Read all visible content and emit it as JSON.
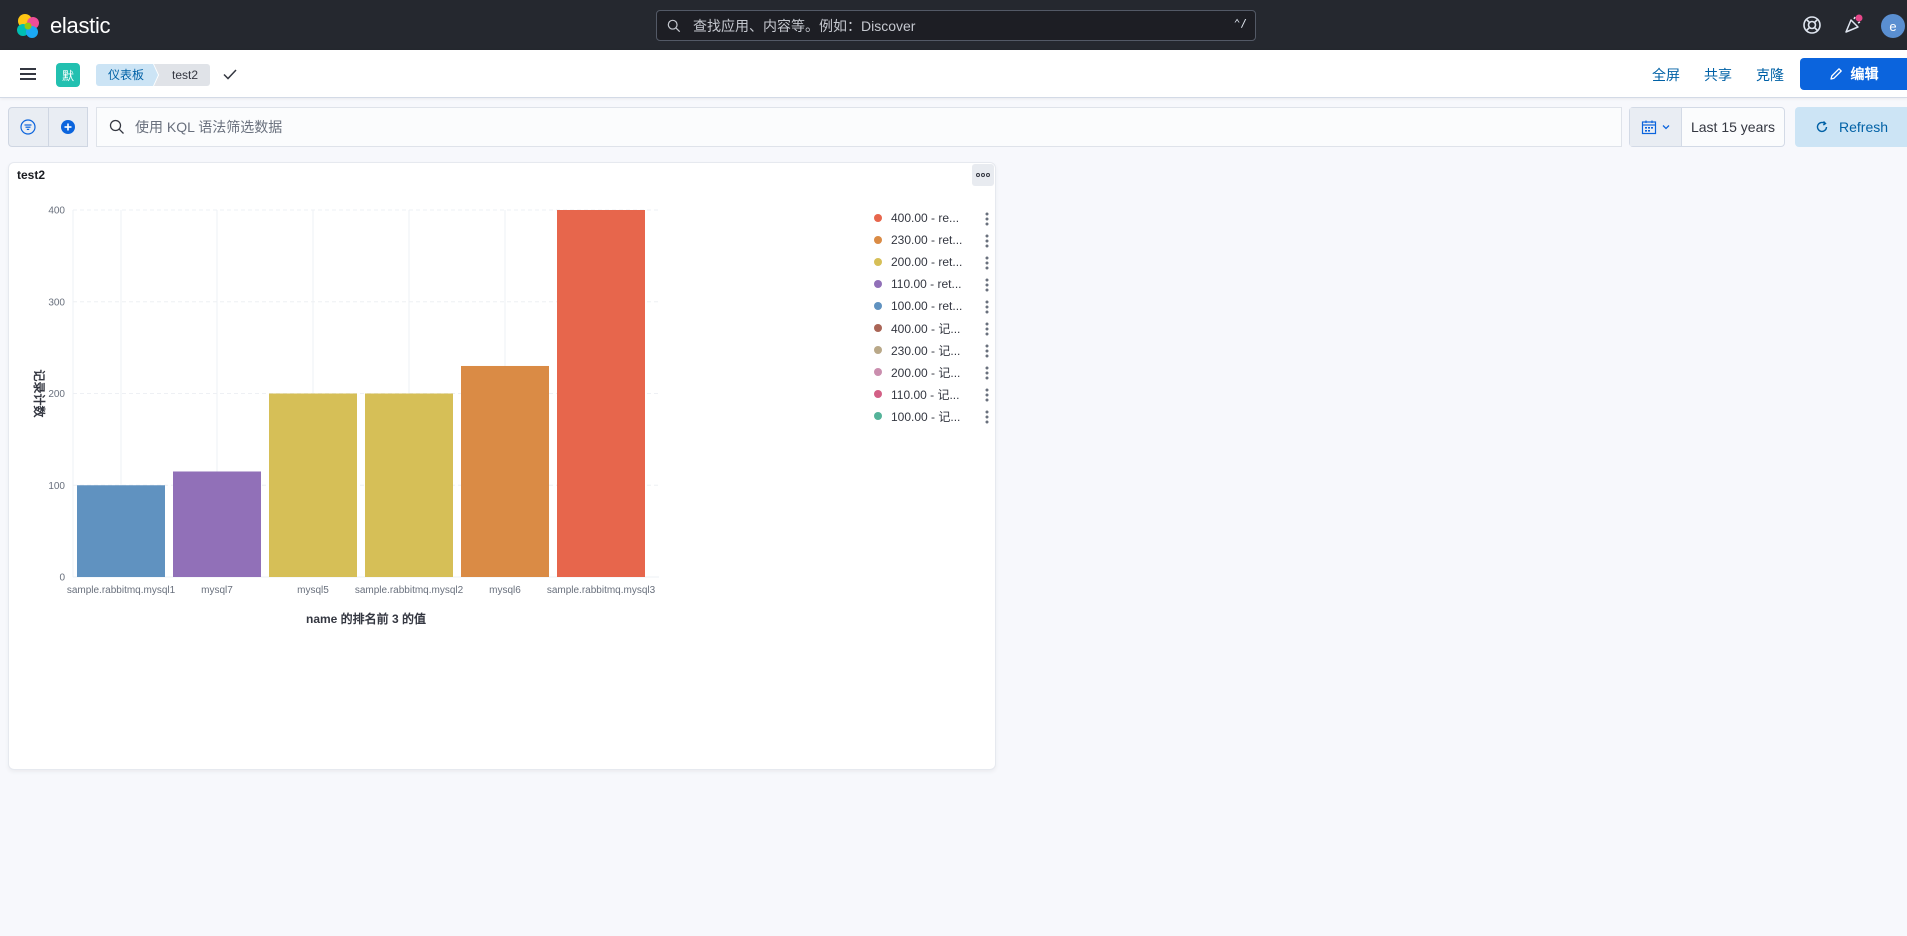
{
  "header": {
    "brand": "elastic",
    "search_placeholder": "查找应用、内容等。例如：Discover",
    "search_shortcut": "⌃/",
    "avatar_letter": "e",
    "colors": {
      "bg": "#25282f",
      "notify_dot": "#e7478a"
    }
  },
  "subbar": {
    "space_initial": "默",
    "breadcrumbs": [
      "仪表板",
      "test2"
    ],
    "fullscreen_label": "全屏",
    "share_label": "共享",
    "clone_label": "克隆",
    "edit_label": "编辑"
  },
  "query": {
    "kql_placeholder": "使用 KQL 语法筛选数据",
    "time_range": "Last 15 years",
    "refresh_label": "Refresh"
  },
  "panel": {
    "title": "test2",
    "legend": [
      {
        "label": "400.00 - re...",
        "color": "#e7664c"
      },
      {
        "label": "230.00 - ret...",
        "color": "#da8b45"
      },
      {
        "label": "200.00 - ret...",
        "color": "#d6bf57"
      },
      {
        "label": "110.00 - ret...",
        "color": "#9170b8"
      },
      {
        "label": "100.00 - ret...",
        "color": "#6092c0"
      },
      {
        "label": "400.00 - 记...",
        "color": "#aa6556"
      },
      {
        "label": "230.00 - 记...",
        "color": "#b9a888"
      },
      {
        "label": "200.00 - 记...",
        "color": "#ca8eae"
      },
      {
        "label": "110.00 - 记...",
        "color": "#d36086"
      },
      {
        "label": "100.00 - 记...",
        "color": "#54b399"
      }
    ]
  },
  "chart_data": {
    "type": "bar",
    "title": "",
    "xlabel": "name 的排名前 3 的值",
    "ylabel": "记录计数",
    "categories": [
      "sample.rabbitmq.mysql1",
      "mysql7",
      "mysql5",
      "sample.rabbitmq.mysql2",
      "mysql6",
      "sample.rabbitmq.mysql3"
    ],
    "values": [
      100,
      115,
      200,
      200,
      230,
      400
    ],
    "bar_colors": [
      "#6092c0",
      "#9170b8",
      "#d6bf57",
      "#d6bf57",
      "#da8b45",
      "#e7664c"
    ],
    "yticks": [
      0,
      100,
      200,
      300,
      400
    ],
    "ylim": [
      0,
      400
    ],
    "grid": true,
    "legend_position": "right"
  }
}
